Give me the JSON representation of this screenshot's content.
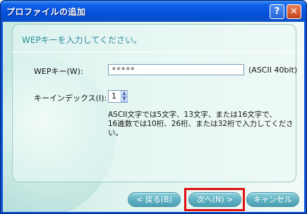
{
  "window": {
    "title": "プロファイルの追加",
    "help_label": "?",
    "close_label": "✕"
  },
  "heading": "WEPキーを入力してください。",
  "wep_key": {
    "label": "WEPキー(W):",
    "value": "*****",
    "hint": "(ASCII 40bit)"
  },
  "key_index": {
    "label": "キーインデックス(I):",
    "value": "1",
    "up_label": "▲",
    "down_label": "▼"
  },
  "description": [
    "ASCII文字では5文字、13文字、または16文字で、",
    "16進数では10桁、26桁、または32桁で入力してくださ",
    "い。"
  ],
  "buttons": {
    "back": "< 戻る(B)",
    "next": "次へ(N) >",
    "cancel": "キャンセル"
  },
  "colors": {
    "title_bar": "#0550db",
    "accent_text": "#2b8b9a",
    "button": "#5fb1c2",
    "highlight": "#e01010"
  }
}
